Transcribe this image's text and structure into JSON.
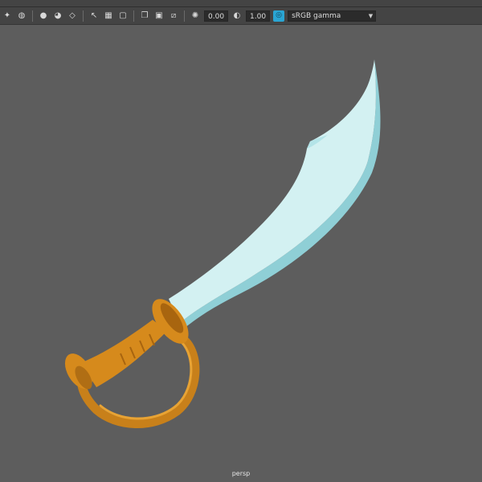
{
  "toolbar": {
    "exposure_value": "0.00",
    "gamma_value": "1.00",
    "color_space": "sRGB gamma"
  },
  "viewport": {
    "camera_label": "persp"
  },
  "colors": {
    "background": "#5d5d5d",
    "toolbar": "#444444",
    "blade_face": "#cdeff0",
    "blade_edge": "#8fcfd6",
    "hilt": "#d68a1c",
    "hilt_shadow": "#9a5e10",
    "accent": "#2aa5d3"
  }
}
